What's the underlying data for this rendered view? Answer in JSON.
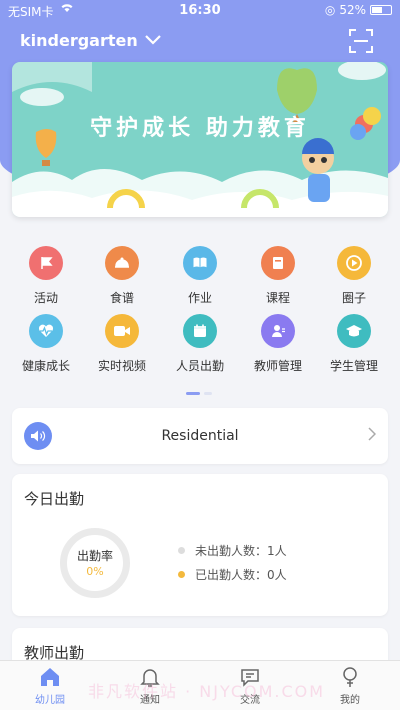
{
  "status_bar": {
    "carrier": "无SIM卡",
    "time": "16:30",
    "battery": "52%"
  },
  "nav": {
    "title": "kindergarten"
  },
  "banner": {
    "slogan": "守护成长 助力教育"
  },
  "grid": [
    {
      "label": "活动",
      "icon": "flag-icon",
      "color": "#f07070"
    },
    {
      "label": "食谱",
      "icon": "dish-icon",
      "color": "#ef8a4a"
    },
    {
      "label": "作业",
      "icon": "book-icon",
      "color": "#5ab8e8"
    },
    {
      "label": "课程",
      "icon": "course-icon",
      "color": "#f08050"
    },
    {
      "label": "圈子",
      "icon": "play-icon",
      "color": "#f5b83a"
    },
    {
      "label": "健康成长",
      "icon": "heartbeat-icon",
      "color": "#5bbfe8"
    },
    {
      "label": "实时视频",
      "icon": "video-icon",
      "color": "#f5b83a"
    },
    {
      "label": "人员出勤",
      "icon": "calendar-icon",
      "color": "#3fbcc0"
    },
    {
      "label": "教师管理",
      "icon": "teacher-icon",
      "color": "#8a7af0"
    },
    {
      "label": "学生管理",
      "icon": "graduation-cap-icon",
      "color": "#3fbcc0"
    }
  ],
  "notice": {
    "text": "Residential"
  },
  "attendance": {
    "title": "今日出勤",
    "rate_label": "出勤率",
    "rate_value": "0%",
    "absent": "未出勤人数：1人",
    "present": "已出勤人数：0人",
    "absent_color": "#dddddd",
    "present_color": "#f3b93d"
  },
  "teacher_attendance": {
    "title": "教师出勤"
  },
  "tabs": [
    {
      "label": "幼儿园",
      "icon": "home-icon"
    },
    {
      "label": "通知",
      "icon": "bell-icon"
    },
    {
      "label": "交流",
      "icon": "chat-icon"
    },
    {
      "label": "我的",
      "icon": "profile-icon"
    }
  ],
  "colors": {
    "primary": "#8b9cf2",
    "accent": "#6e8ef2"
  },
  "watermark": "非凡软件站 · NJYCOM.COM"
}
